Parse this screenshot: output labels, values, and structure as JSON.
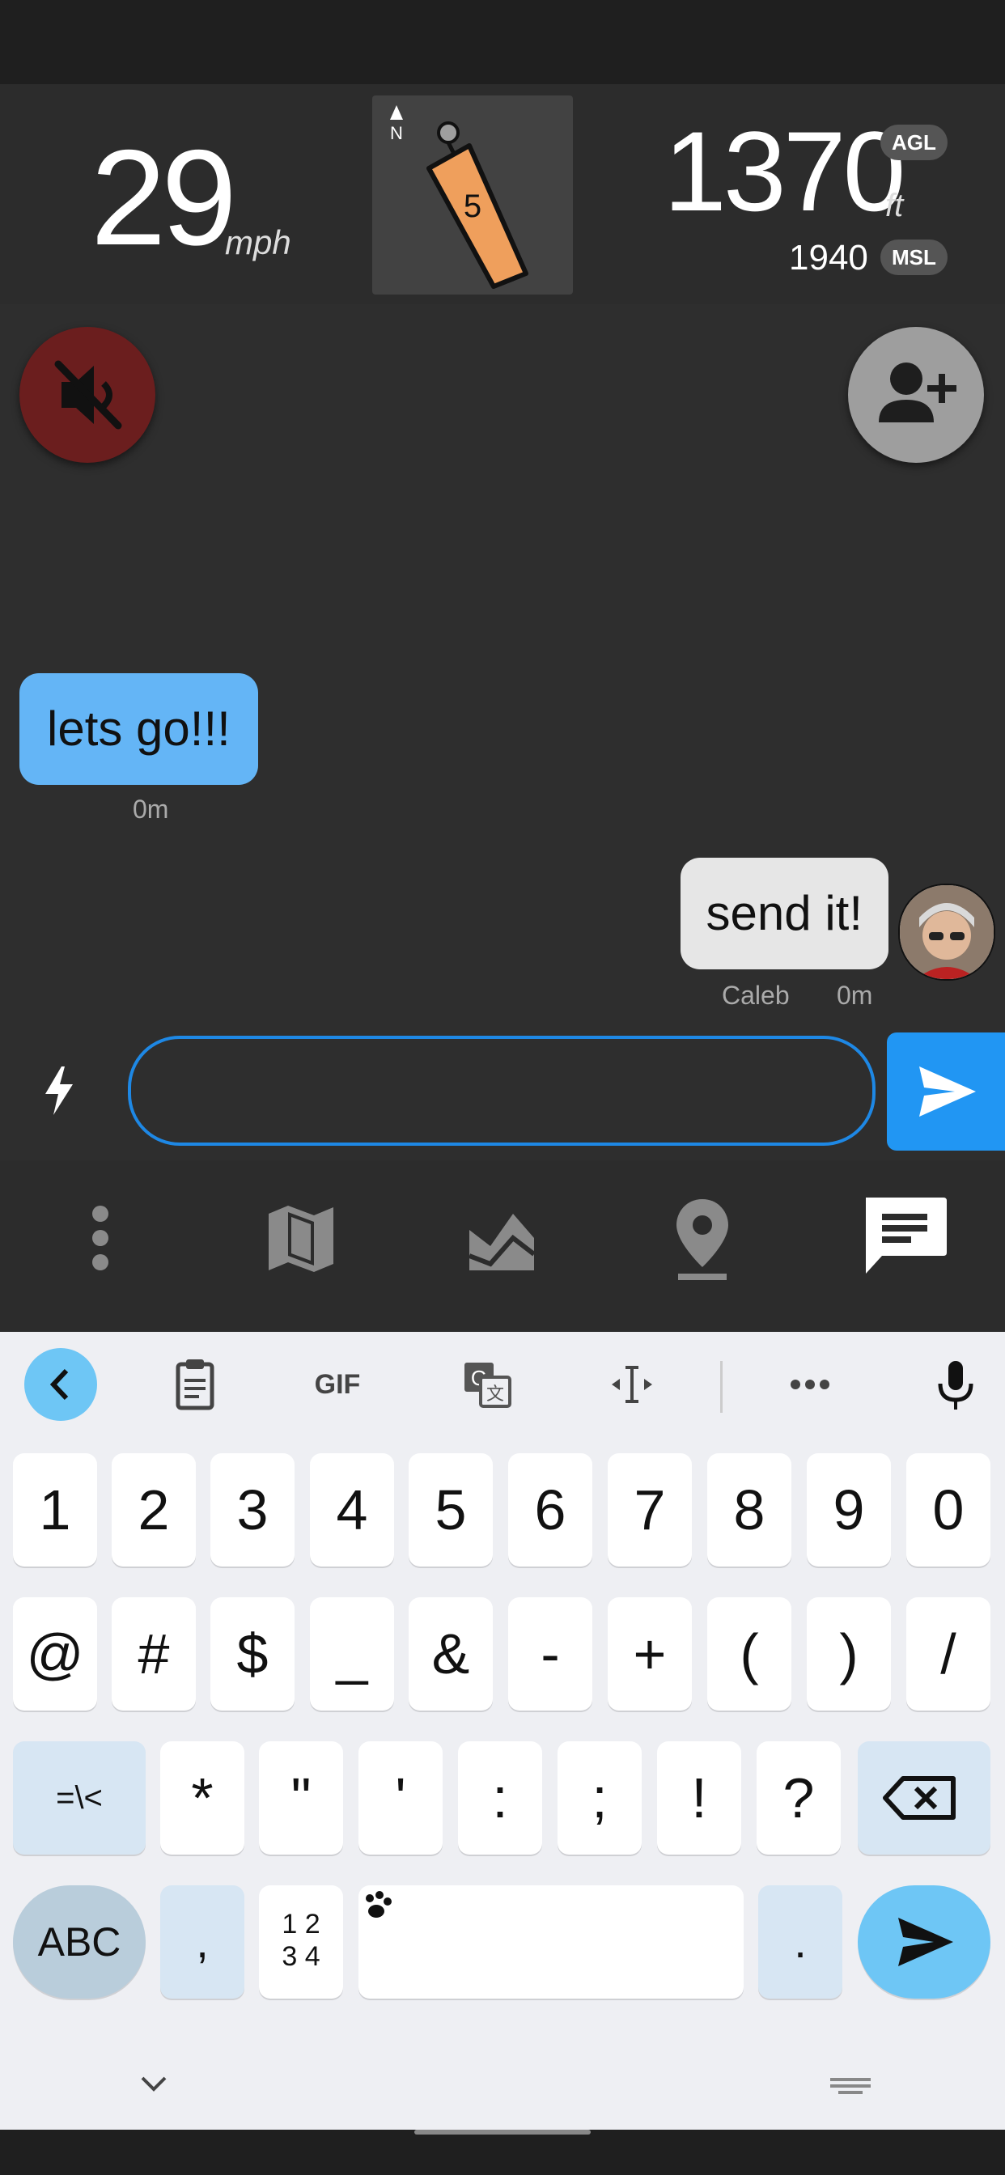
{
  "hud": {
    "speed_value": "29",
    "speed_unit": "mph",
    "wind_north": "N",
    "wind_value": "5",
    "altitude_agl": "1370",
    "altitude_unit": "ft",
    "agl_label": "AGL",
    "altitude_msl": "1940",
    "msl_label": "MSL"
  },
  "chat": {
    "messages": [
      {
        "text": "lets go!!!",
        "time": "0m"
      },
      {
        "text": "send it!",
        "sender": "Caleb",
        "time": "0m"
      }
    ],
    "input_placeholder": ""
  },
  "nav": {
    "items": [
      "more-icon",
      "map-icon",
      "terrain-icon",
      "location-icon",
      "chat-icon"
    ]
  },
  "keyboard": {
    "toolbar": {
      "gif": "GIF"
    },
    "row1": [
      "1",
      "2",
      "3",
      "4",
      "5",
      "6",
      "7",
      "8",
      "9",
      "0"
    ],
    "row2": [
      "@",
      "#",
      "$",
      "_",
      "&",
      "-",
      "+",
      "(",
      ")",
      "/"
    ],
    "row3": [
      "=\\<",
      "*",
      "\"",
      "'",
      ":",
      ";",
      "!",
      "?"
    ],
    "row4": {
      "abc": "ABC",
      "comma": ",",
      "numpad": "1 2\n3 4",
      "period": "."
    }
  },
  "colors": {
    "accent": "#2196f3",
    "bubble_left": "#64b5f6",
    "mute": "#6b1e1e"
  }
}
